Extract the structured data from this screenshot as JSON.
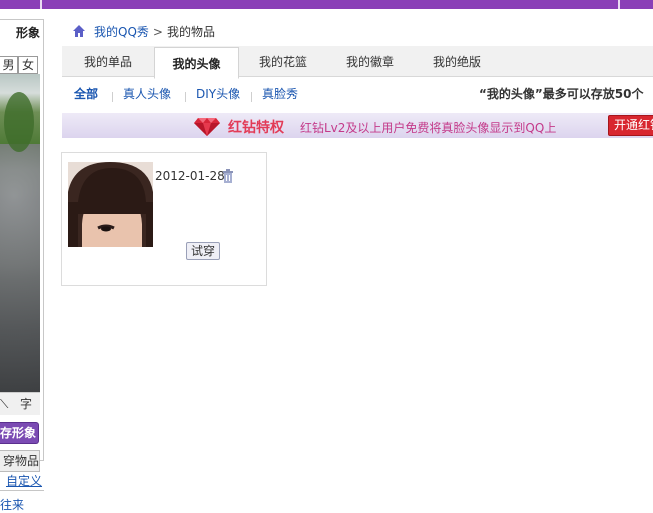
{
  "sidebar": {
    "title": "形象",
    "gender_male": "男",
    "gender_female": "女",
    "tools_left": "⟍",
    "tools_right": "字",
    "save_label": "存形象",
    "wear_label": "穿物品",
    "custom_label": "自定义",
    "more_label": "往来"
  },
  "breadcrumb": {
    "home_link": "我的QQ秀",
    "separator": ">",
    "current": "我的物品"
  },
  "tabs": [
    {
      "label": "我的单品"
    },
    {
      "label": "我的头像"
    },
    {
      "label": "我的花篮"
    },
    {
      "label": "我的徽章"
    },
    {
      "label": "我的绝版"
    }
  ],
  "subnav": {
    "items": [
      {
        "label": "全部"
      },
      {
        "label": "真人头像"
      },
      {
        "label": "DIY头像"
      },
      {
        "label": "真脸秀"
      }
    ],
    "note": "“我的头像”最多可以存放50个"
  },
  "banner": {
    "title": "红钻特权",
    "text": "红钻Lv2及以上用户免费将真脸头像显示到QQ上",
    "button_label": "开通红钻"
  },
  "items": [
    {
      "date": "2012-01-28",
      "try_label": "试穿"
    }
  ],
  "colors": {
    "top_bar": "#8a3fb7",
    "link": "#1a56b0",
    "banner_title": "#e23b57",
    "banner_text": "#c43a8a",
    "banner_button": "#d8262f"
  }
}
